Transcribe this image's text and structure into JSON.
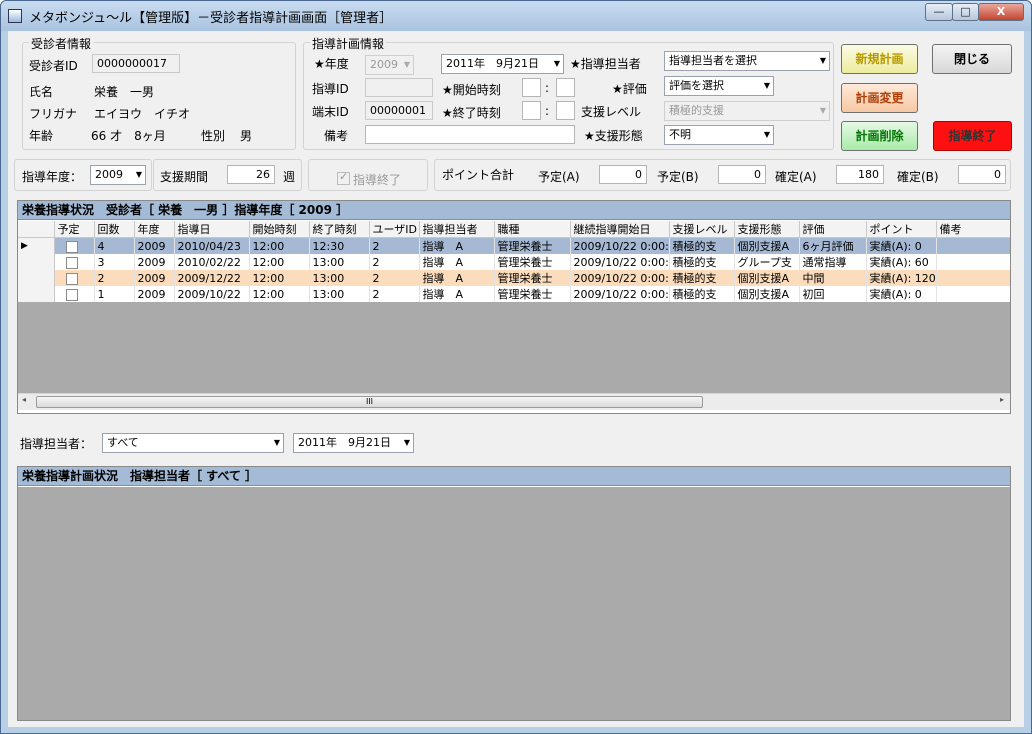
{
  "window": {
    "title": "メタボンジュ～ル【管理版】－受診者指導計画画面［管理者］",
    "minimize_glyph": "—",
    "maximize_glyph": "□",
    "close_glyph": "X"
  },
  "patient": {
    "group_label": "受診者情報",
    "id_label": "受診者ID",
    "id_value": "0000000017",
    "name_label": "氏名",
    "name_value": "栄養　一男",
    "kana_label": "フリガナ",
    "kana_value": "エイヨウ　イチオ",
    "age_label": "年齢",
    "age_value": "66 才　8ヶ月",
    "sex_label": "性別",
    "sex_value": "男"
  },
  "plan": {
    "group_label": "指導計画情報",
    "year_label": "★年度",
    "year_value": "2009",
    "date_value": "2011年　9月21日",
    "guidance_id_label": "指導ID",
    "guidance_id_value": "",
    "terminal_id_label": "端末ID",
    "terminal_id_value": "00000001",
    "note_label": "備考",
    "note_value": "",
    "start_time_label": "★開始時刻",
    "end_time_label": "★終了時刻",
    "time_separator": ":",
    "staff_label": "★指導担当者",
    "staff_value": "指導担当者を選択",
    "eval_label": "★評価",
    "eval_value": "評価を選択",
    "support_level_label": "支援レベル",
    "support_level_value": "積極的支援",
    "support_form_label": "★支援形態",
    "support_form_value": "不明"
  },
  "buttons": {
    "new_plan": "新規計画",
    "close": "閉じる",
    "change_plan": "計画変更",
    "delete_plan": "計画削除",
    "end_guidance": "指導終了"
  },
  "period_bar": {
    "year_label": "指導年度：",
    "year_value": "2009",
    "period_label": "支援期間",
    "period_value": "26",
    "period_unit": "週",
    "finished_label": "指導終了",
    "points_label": "ポイント合計",
    "planned_a_label": "予定(A)",
    "planned_a_value": "0",
    "planned_b_label": "予定(B)",
    "planned_b_value": "0",
    "confirmed_a_label": "確定(A)",
    "confirmed_a_value": "180",
    "confirmed_b_label": "確定(B)",
    "confirmed_b_value": "0"
  },
  "status_grid": {
    "caption": "栄養指導状況　受診者［ 栄養　一男 ］指導年度［ 2009 ］",
    "columns": [
      "予定",
      "回数",
      "年度",
      "指導日",
      "開始時刻",
      "終了時刻",
      "ユーザID",
      "指導担当者",
      "職種",
      "継続指導開始日",
      "支援レベル",
      "支援形態",
      "評価",
      "ポイント",
      "備考"
    ],
    "current_row_glyph": "▶",
    "rows": [
      {
        "count": "4",
        "year": "2009",
        "date": "2010/04/23",
        "start": "12:00",
        "end": "12:30",
        "user_id": "2",
        "staff": "指導　A",
        "job": "管理栄養士",
        "cont_start": "2009/10/22 0:00:",
        "level": "積極的支",
        "form": "個別支援A",
        "eval": "6ヶ月評価",
        "points": "実績(A): 0",
        "note": ""
      },
      {
        "count": "3",
        "year": "2009",
        "date": "2010/02/22",
        "start": "12:00",
        "end": "13:00",
        "user_id": "2",
        "staff": "指導　A",
        "job": "管理栄養士",
        "cont_start": "2009/10/22 0:00:",
        "level": "積極的支",
        "form": "グループ支",
        "eval": "通常指導",
        "points": "実績(A): 60",
        "note": ""
      },
      {
        "count": "2",
        "year": "2009",
        "date": "2009/12/22",
        "start": "12:00",
        "end": "13:00",
        "user_id": "2",
        "staff": "指導　A",
        "job": "管理栄養士",
        "cont_start": "2009/10/22 0:00:",
        "level": "積極的支",
        "form": "個別支援A",
        "eval": "中間",
        "points": "実績(A): 120",
        "note": ""
      },
      {
        "count": "1",
        "year": "2009",
        "date": "2009/10/22",
        "start": "12:00",
        "end": "13:00",
        "user_id": "2",
        "staff": "指導　A",
        "job": "管理栄養士",
        "cont_start": "2009/10/22 0:00:",
        "level": "積極的支",
        "form": "個別支援A",
        "eval": "初回",
        "points": "実績(A): 0",
        "note": ""
      }
    ],
    "scroll_thumb_glyph": "III",
    "scroll_left_glyph": "◂",
    "scroll_right_glyph": "▸"
  },
  "filter": {
    "staff_label": "指導担当者：",
    "staff_value": "すべて",
    "date_value": "2011年　9月21日"
  },
  "plan_grid": {
    "caption": "栄養指導計画状況　指導担当者［ すべて ］"
  }
}
